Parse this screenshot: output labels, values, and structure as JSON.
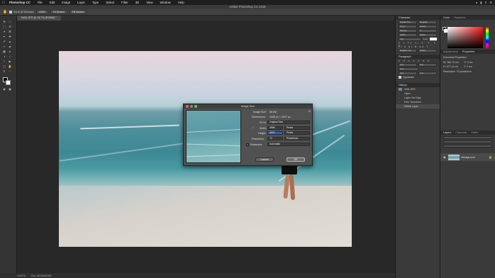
{
  "menubar": {
    "app": "Photoshop CC",
    "items": [
      "File",
      "Edit",
      "Image",
      "Layer",
      "Type",
      "Select",
      "Filter",
      "3D",
      "View",
      "Window",
      "Help"
    ]
  },
  "window_title": "Adobe Photoshop CC 2018",
  "options_bar": {
    "scroll_all": "Scroll All Windows",
    "zoom_100": "100%",
    "fit_screen": "Fit Screen",
    "fill_screen": "Fill Screen"
  },
  "document_tab": "0451.JPG @ 16.7% (RGB/8) *",
  "status_bar": {
    "zoom": "16.67%",
    "doc": "Doc: 68.5M/68.5M"
  },
  "character_panel": {
    "tab": "Character",
    "font": "Myriad Pro",
    "style": "Regular",
    "size": "12 pt",
    "leading": "(Auto)",
    "tracking": "Metrics",
    "kerning": "0",
    "scale_v": "100%",
    "scale_h": "100%",
    "baseline": "0 pt",
    "color_label": "Color:",
    "language": "English: UK",
    "aa": "Sharp"
  },
  "paragraph_panel": {
    "tab": "Paragraph",
    "indent_left": "0 pt",
    "indent_right": "0 pt",
    "indent_first": "0 pt",
    "space_before": "0 pt",
    "space_after": "0 pt",
    "hyphenate": "Hyphenate"
  },
  "history_panel": {
    "tab": "History",
    "doc": "0451.JPG",
    "items": [
      "Open",
      "Layer Via Copy",
      "Free Transform",
      "Delete Layer"
    ]
  },
  "color_panel": {
    "tabs": [
      "Color",
      "Swatches"
    ]
  },
  "properties_panel": {
    "tabs": [
      "Adjustments",
      "Properties"
    ],
    "title": "Document Properties",
    "w": "W: 160.73 cm",
    "h": "H: 107.14 cm",
    "x": "X: 0 cm",
    "y": "Y: 0 cm",
    "resolution": "Resolution: 72 pixels/inch"
  },
  "layers_panel": {
    "tabs": [
      "Layers",
      "Channels",
      "Paths"
    ],
    "layer_name": "Background"
  },
  "image_size_dialog": {
    "title": "Image Size",
    "image_size_label": "Image Size:",
    "image_size_value": "68.6M",
    "dimensions_label": "Dimensions:",
    "dimensions_value": "4556 px × 3037 px",
    "fit_to_label": "Fit To:",
    "fit_to_value": "Original Size",
    "width_label": "Width:",
    "width_value": "4556",
    "width_unit": "Pixels",
    "height_label": "Height:",
    "height_value": "3037",
    "height_unit": "Pixels",
    "resolution_label": "Resolution:",
    "resolution_value": "72",
    "resolution_unit": "Pixels/Inch",
    "resample_label": "Resample:",
    "resample_value": "Automatic",
    "cancel": "Cancel",
    "ok": "OK"
  }
}
